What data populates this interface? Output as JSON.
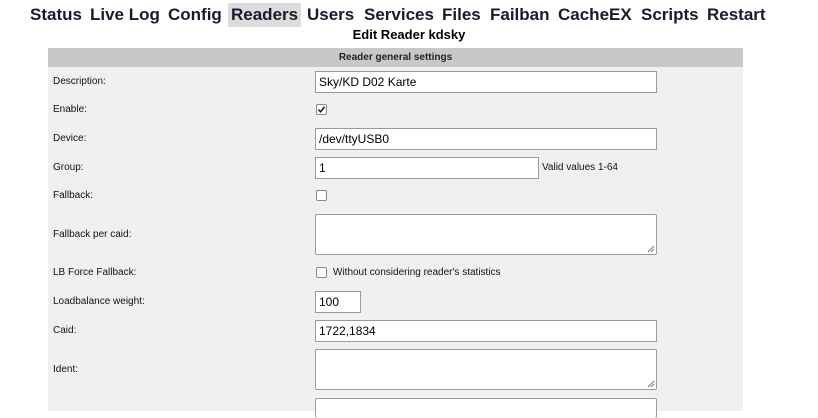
{
  "nav": {
    "items": [
      {
        "label": "Status"
      },
      {
        "label": "Live Log"
      },
      {
        "label": "Config"
      },
      {
        "label": "Readers",
        "active": true
      },
      {
        "label": "Users"
      },
      {
        "label": "Services"
      },
      {
        "label": "Files"
      },
      {
        "label": "Failban"
      },
      {
        "label": "CacheEX"
      },
      {
        "label": "Scripts"
      },
      {
        "label": "Restart"
      }
    ]
  },
  "page": {
    "title": "Edit Reader kdsky"
  },
  "section": {
    "header": "Reader general settings"
  },
  "fields": {
    "description": {
      "label": "Description:",
      "value": "Sky/KD D02 Karte"
    },
    "enable": {
      "label": "Enable:",
      "checked": true
    },
    "device": {
      "label": "Device:",
      "value": "/dev/ttyUSB0"
    },
    "group": {
      "label": "Group:",
      "value": "1",
      "hint": "Valid values 1-64"
    },
    "fallback": {
      "label": "Fallback:",
      "checked": false
    },
    "fallback_per_caid": {
      "label": "Fallback per caid:",
      "value": ""
    },
    "lb_force_fallback": {
      "label": "LB Force Fallback:",
      "checked": false,
      "hint": "Without considering reader's statistics"
    },
    "loadbalance_weight": {
      "label": "Loadbalance weight:",
      "value": "100"
    },
    "caid": {
      "label": "Caid:",
      "value": "1722,1834"
    },
    "ident": {
      "label": "Ident:",
      "value": ""
    }
  },
  "colors": {
    "nav_text": "#1a1a2e",
    "active_bg": "#dcdcdc",
    "panel_bg": "#f0f0f0",
    "header_bg": "#c8c8c8"
  }
}
